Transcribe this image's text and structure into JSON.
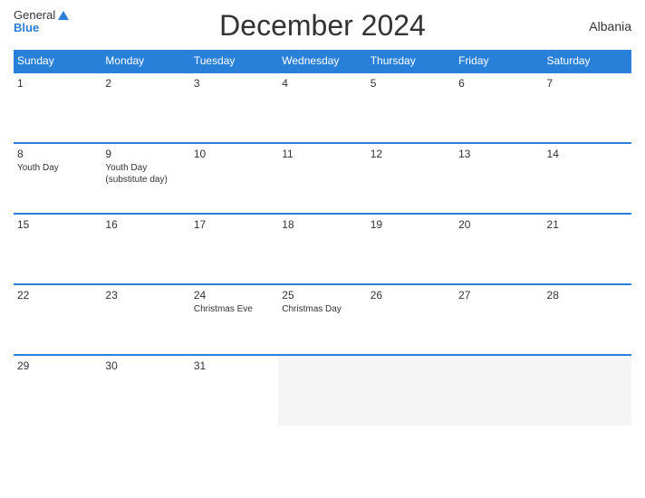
{
  "header": {
    "title": "December 2024",
    "country": "Albania",
    "logo_general": "General",
    "logo_blue": "Blue"
  },
  "weekdays": [
    "Sunday",
    "Monday",
    "Tuesday",
    "Wednesday",
    "Thursday",
    "Friday",
    "Saturday"
  ],
  "weeks": [
    [
      {
        "date": "1",
        "events": []
      },
      {
        "date": "2",
        "events": []
      },
      {
        "date": "3",
        "events": []
      },
      {
        "date": "4",
        "events": []
      },
      {
        "date": "5",
        "events": []
      },
      {
        "date": "6",
        "events": []
      },
      {
        "date": "7",
        "events": []
      }
    ],
    [
      {
        "date": "8",
        "events": [
          "Youth Day"
        ]
      },
      {
        "date": "9",
        "events": [
          "Youth Day",
          "(substitute day)"
        ]
      },
      {
        "date": "10",
        "events": []
      },
      {
        "date": "11",
        "events": []
      },
      {
        "date": "12",
        "events": []
      },
      {
        "date": "13",
        "events": []
      },
      {
        "date": "14",
        "events": []
      }
    ],
    [
      {
        "date": "15",
        "events": []
      },
      {
        "date": "16",
        "events": []
      },
      {
        "date": "17",
        "events": []
      },
      {
        "date": "18",
        "events": []
      },
      {
        "date": "19",
        "events": []
      },
      {
        "date": "20",
        "events": []
      },
      {
        "date": "21",
        "events": []
      }
    ],
    [
      {
        "date": "22",
        "events": []
      },
      {
        "date": "23",
        "events": []
      },
      {
        "date": "24",
        "events": [
          "Christmas Eve"
        ]
      },
      {
        "date": "25",
        "events": [
          "Christmas Day"
        ]
      },
      {
        "date": "26",
        "events": []
      },
      {
        "date": "27",
        "events": []
      },
      {
        "date": "28",
        "events": []
      }
    ],
    [
      {
        "date": "29",
        "events": []
      },
      {
        "date": "30",
        "events": []
      },
      {
        "date": "31",
        "events": []
      },
      {
        "date": "",
        "events": []
      },
      {
        "date": "",
        "events": []
      },
      {
        "date": "",
        "events": []
      },
      {
        "date": "",
        "events": []
      }
    ]
  ]
}
